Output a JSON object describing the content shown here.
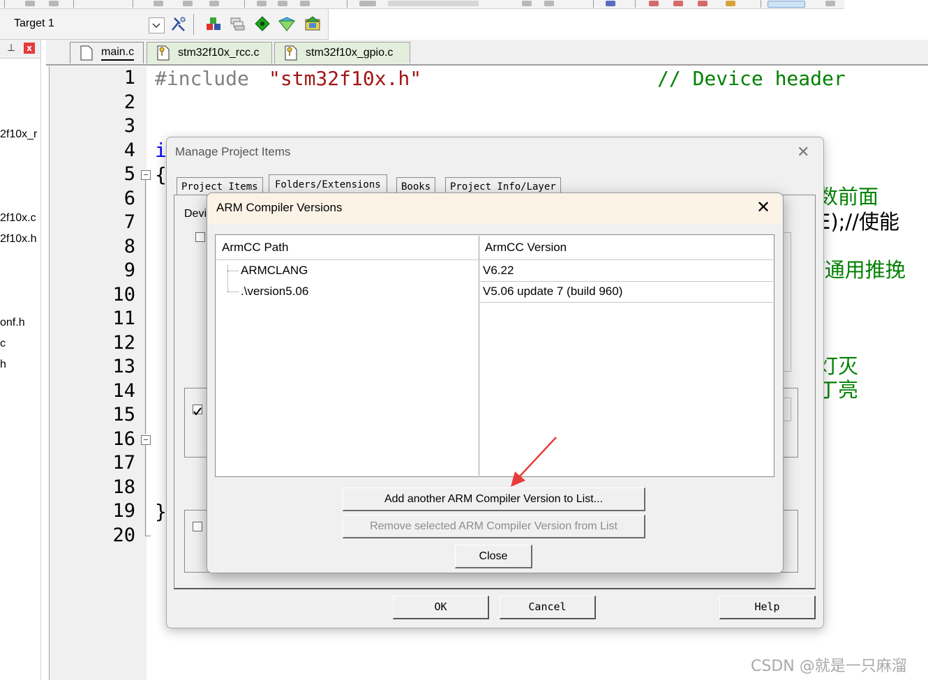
{
  "toolbar": {
    "target_name": "Target 1",
    "icons": [
      "options-for-target-icon",
      "file-extensions-icon",
      "manage-books-icon",
      "select-packs-icon",
      "manage-rte-icon",
      "pack-installer-icon"
    ]
  },
  "left_pane": {
    "items": [
      "2f10x_r",
      "2f10x.c",
      "2f10x.h",
      "onf.h",
      "c",
      "h"
    ]
  },
  "editor": {
    "tabs": [
      {
        "label": "main.c",
        "active": true
      },
      {
        "label": "stm32f10x_rcc.c",
        "active": false
      },
      {
        "label": "stm32f10x_gpio.c",
        "active": false
      }
    ],
    "line_numbers": [
      "1",
      "2",
      "3",
      "4",
      "5",
      "6",
      "7",
      "8",
      "9",
      "10",
      "11",
      "12",
      "13",
      "14",
      "15",
      "16",
      "17",
      "18",
      "19",
      "20"
    ],
    "code": {
      "include_directive": "#include",
      "include_file": "\"stm32f10x.h\"",
      "include_comment": "// Device header",
      "line4_fragment": "i",
      "line5_brace": "{",
      "line19_brace": "}",
      "right_fragment_1": "数前面",
      "right_fragment_2": "E);//使能",
      "right_fragment_3": "/通用推挽",
      "right_fragment_4": "灯灭",
      "right_fragment_5": "丁亮"
    }
  },
  "manage_dialog": {
    "title": "Manage Project Items",
    "tabs": [
      "Project Items",
      "Folders/Extensions",
      "Books",
      "Project Info/Layer"
    ],
    "device_label_fragment": "Devi",
    "buttons": {
      "ok": "OK",
      "cancel": "Cancel",
      "help": "Help"
    }
  },
  "compiler_dialog": {
    "title": "ARM Compiler Versions",
    "columns": [
      "ArmCC Path",
      "ArmCC Version"
    ],
    "rows": [
      {
        "path": "ARMCLANG",
        "version": "V6.22"
      },
      {
        "path": ".\\version5.06",
        "version": "V5.06 update 7 (build 960)"
      }
    ],
    "buttons": {
      "add": "Add another ARM Compiler Version to List...",
      "remove": "Remove selected ARM Compiler Version from List",
      "close": "Close"
    }
  },
  "watermark": "CSDN @就是一只麻溜",
  "colors": {
    "code_string": "#a31515",
    "code_comment": "#008000",
    "code_keyword": "#0000ff",
    "annotation_arrow": "#e83b3b",
    "dialog_titlebar": "#fbf3e6"
  }
}
